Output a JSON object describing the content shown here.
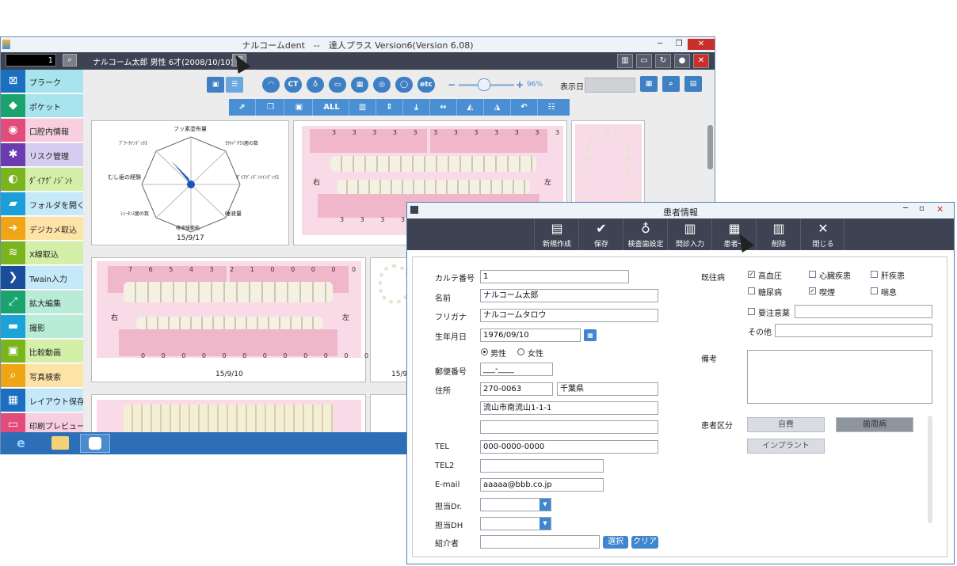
{
  "main_window": {
    "title": "ナルコームdent　--　達人プラス Version6(Version 6.08)",
    "id_value": "1",
    "patient_header": "ナルコーム太郎 男性 6才(2008/10/10)",
    "zoom": "96%",
    "display_date_label": "表示日"
  },
  "sidebar": {
    "items": [
      {
        "label": "プラーク",
        "color": "#1b6fc0",
        "bg": "#a8e4ee",
        "icon": "plaque-icon"
      },
      {
        "label": "ポケット",
        "color": "#1aa36e",
        "bg": "#a8e4ee",
        "icon": "pocket-icon"
      },
      {
        "label": "口腔内情報",
        "color": "#e24b7a",
        "bg": "#f7cfe0",
        "icon": "mouth-icon"
      },
      {
        "label": "リスク管理",
        "color": "#6b3bb0",
        "bg": "#d6ccef",
        "icon": "risk-icon"
      },
      {
        "label": "ﾀﾞｲｱｸﾞﾉｼﾞﾝﾄ",
        "color": "#7ab51d",
        "bg": "#d4f0a8",
        "icon": "diagnodent-icon"
      },
      {
        "label": "フォルダを開く",
        "color": "#1a9fd8",
        "bg": "#c6e9fa",
        "icon": "folder-icon"
      },
      {
        "label": "デジカメ取込",
        "color": "#f0a516",
        "bg": "#fde3a6",
        "icon": "camera-import-icon"
      },
      {
        "label": "X線取込",
        "color": "#7ab51d",
        "bg": "#d4f0a8",
        "icon": "xray-icon"
      },
      {
        "label": "Twain入力",
        "color": "#1b4e9a",
        "bg": "#c6e9fa",
        "icon": "twain-icon"
      },
      {
        "label": "拡大編集",
        "color": "#1aa36e",
        "bg": "#b8ecd8",
        "icon": "zoom-edit-icon"
      },
      {
        "label": "撮影",
        "color": "#1aa3d8",
        "bg": "#b8ecd8",
        "icon": "capture-icon"
      },
      {
        "label": "比較動画",
        "color": "#7ab51d",
        "bg": "#d4f0a8",
        "icon": "compare-video-icon"
      },
      {
        "label": "写真検索",
        "color": "#f0a516",
        "bg": "#fde3a6",
        "icon": "photo-search-icon"
      },
      {
        "label": "レイアウト保存",
        "color": "#1b6fc0",
        "bg": "#c6e9fa",
        "icon": "layout-save-icon"
      },
      {
        "label": "印刷プレビュー",
        "color": "#e24b7a",
        "bg": "#f7cfe0",
        "icon": "print-preview-icon"
      }
    ]
  },
  "toolbar_top": [
    "CT",
    "etc"
  ],
  "toolbar_second": {
    "all_label": "ALL"
  },
  "radar": {
    "labels": [
      "フッ素塗布量",
      "ﾗｸﾄﾊﾞﾁﾗｽ菌の数",
      "ﾀﾞｲｱｸﾞﾉﾃﾞﾝﾄｲﾝﾃﾞｯｸｽ",
      "唾液量",
      "唾液緩衝能",
      "ﾐｭｰﾀﾝｽ菌の数",
      "むし歯の経験",
      "ﾌﾟﾗｰｸｲﾝﾃﾞｯｸｽ"
    ],
    "date": "15/9/17"
  },
  "chart1": {
    "numbers_top": "3 3 3 3 3 3 3 3 3 3 3 3 3 3 3 3",
    "numbers_bottom": "3 3 3 3 3 3 3 3 3 3 3 3 3 3 3 3",
    "left": "右",
    "right": "左"
  },
  "chart2": {
    "numbers_top": "7 6 5 4 3 2 1 0 0 0 0 0 0 0",
    "numbers_bottom": "0 0 0 0 0 0 0 0 0 0 0 0 0 0",
    "left": "右",
    "right": "左",
    "date": "15/9/10",
    "date_partial": "15/9"
  },
  "dialog": {
    "title": "患者情報",
    "toolbar": [
      {
        "label": "新規作成",
        "icon": "new-document-icon"
      },
      {
        "label": "保存",
        "icon": "save-check-icon"
      },
      {
        "label": "検査歯設定",
        "icon": "tooth-icon"
      },
      {
        "label": "問診入力",
        "icon": "clipboard-icon"
      },
      {
        "label": "患者一",
        "icon": "patient-list-icon"
      },
      {
        "label": "削除",
        "icon": "trash-icon"
      },
      {
        "label": "閉じる",
        "icon": "close-icon"
      }
    ],
    "fields": {
      "chart_no": {
        "label": "カルテ番号",
        "value": "1"
      },
      "name": {
        "label": "名前",
        "value": "ナルコーム太郎"
      },
      "furigana": {
        "label": "フリガナ",
        "value": "ナルコームタロウ"
      },
      "birthday": {
        "label": "生年月日",
        "value": "1976/09/10"
      },
      "gender_male": "男性",
      "gender_female": "女性",
      "postal": {
        "label": "郵便番号",
        "value": "___-____"
      },
      "address": {
        "label": "住所",
        "zip": "270-0063",
        "pref": "千葉県",
        "line1": "流山市南流山1-1-1",
        "line2": ""
      },
      "tel": {
        "label": "TEL",
        "value": "000-0000-0000"
      },
      "tel2": {
        "label": "TEL2",
        "value": ""
      },
      "email": {
        "label": "E-mail",
        "value": "aaaaa@bbb.co.jp"
      },
      "doctor": {
        "label": "担当Dr.",
        "value": ""
      },
      "dh": {
        "label": "担当DH",
        "value": ""
      },
      "referrer": {
        "label": "紹介者",
        "value": "",
        "select": "選択",
        "clear": "クリア"
      }
    },
    "history": {
      "label": "既往病",
      "items": [
        {
          "label": "高血圧",
          "checked": true
        },
        {
          "label": "心臓疾患",
          "checked": false
        },
        {
          "label": "肝疾患",
          "checked": false
        },
        {
          "label": "糖尿病",
          "checked": false
        },
        {
          "label": "喫煙",
          "checked": true
        },
        {
          "label": "喘息",
          "checked": false
        }
      ],
      "caution_label": "要注意薬",
      "other_label": "その他"
    },
    "notes_label": "備考",
    "category": {
      "label": "患者区分",
      "self_pay": "自費",
      "periodontal": "歯周病",
      "implant": "インプラント"
    }
  }
}
